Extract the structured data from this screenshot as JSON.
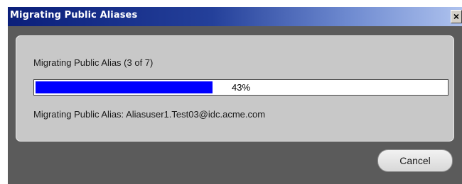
{
  "window": {
    "title": "Migrating Public Aliases",
    "close_label": "×"
  },
  "panel": {
    "status_title": "Migrating Public Alias (3 of 7)",
    "progress_percent": 43,
    "progress_label": "43%",
    "status_detail": "Migrating Public Alias: Aliasuser1.Test03@idc.acme.com"
  },
  "buttons": {
    "cancel_label": "Cancel"
  },
  "colors": {
    "progress_fill": "#0000ff",
    "title_bar_start": "#0b1f7a",
    "title_bar_end": "#aec2ee"
  }
}
